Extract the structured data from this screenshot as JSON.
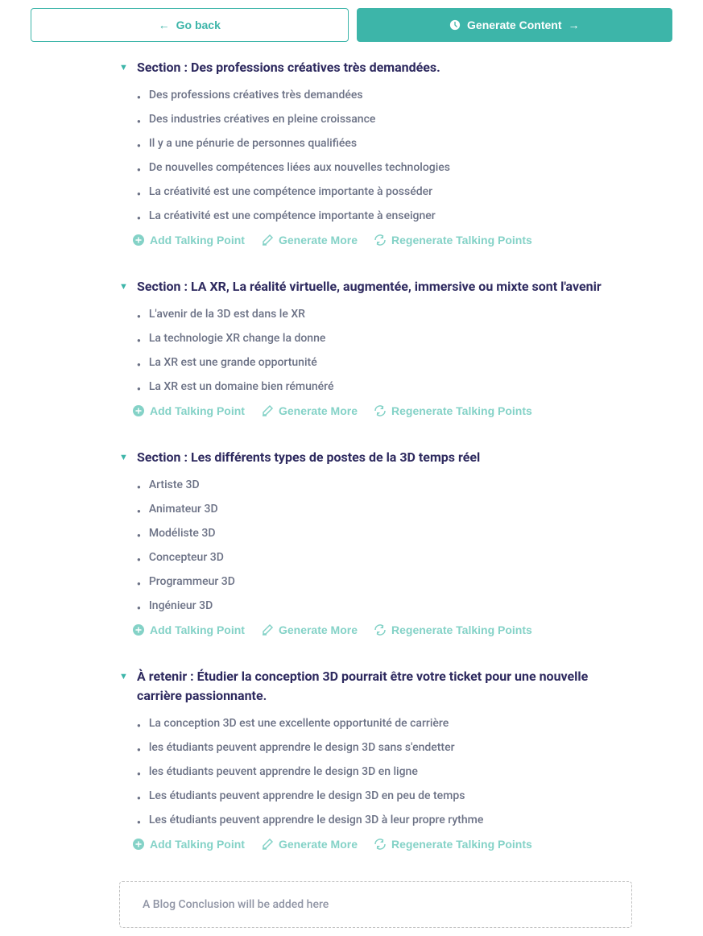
{
  "buttons": {
    "goBack": "Go back",
    "generateContent": "Generate Content"
  },
  "sections": [
    {
      "title": "Section : Des professions créatives très demandées.",
      "points": [
        "Des professions créatives très demandées",
        "Des industries créatives en pleine croissance",
        "Il y a une pénurie de personnes qualifiées",
        "De nouvelles compétences liées aux nouvelles technologies",
        "La créativité est une compétence importante à posséder",
        "La créativité est une compétence importante à enseigner"
      ]
    },
    {
      "title": "Section : LA XR, La réalité virtuelle, augmentée, immersive ou mixte sont l'avenir",
      "points": [
        "L'avenir de la 3D est dans le XR",
        "La technologie XR change la donne",
        "La XR est une grande opportunité",
        "La XR est un domaine bien rémunéré"
      ]
    },
    {
      "title": "Section : Les différents types de postes de la 3D temps réel",
      "points": [
        "Artiste 3D",
        "Animateur 3D",
        "Modéliste 3D",
        "Concepteur 3D",
        "Programmeur 3D",
        "Ingénieur 3D"
      ]
    },
    {
      "title": "À retenir : Étudier la conception 3D pourrait être votre ticket pour une nouvelle carrière passionnante.",
      "points": [
        "La conception 3D est une excellente opportunité de carrière",
        "les étudiants peuvent apprendre le design 3D sans s'endetter",
        "les étudiants peuvent apprendre le design 3D en ligne",
        "Les étudiants peuvent apprendre le design 3D en peu de temps",
        "Les étudiants peuvent apprendre le design 3D à leur propre rythme"
      ]
    }
  ],
  "actions": {
    "addTalkingPoint": "Add Talking Point",
    "generateMore": "Generate More",
    "regenerateTalkingPoints": "Regenerate Talking Points"
  },
  "conclusion": "A Blog Conclusion will be added here"
}
